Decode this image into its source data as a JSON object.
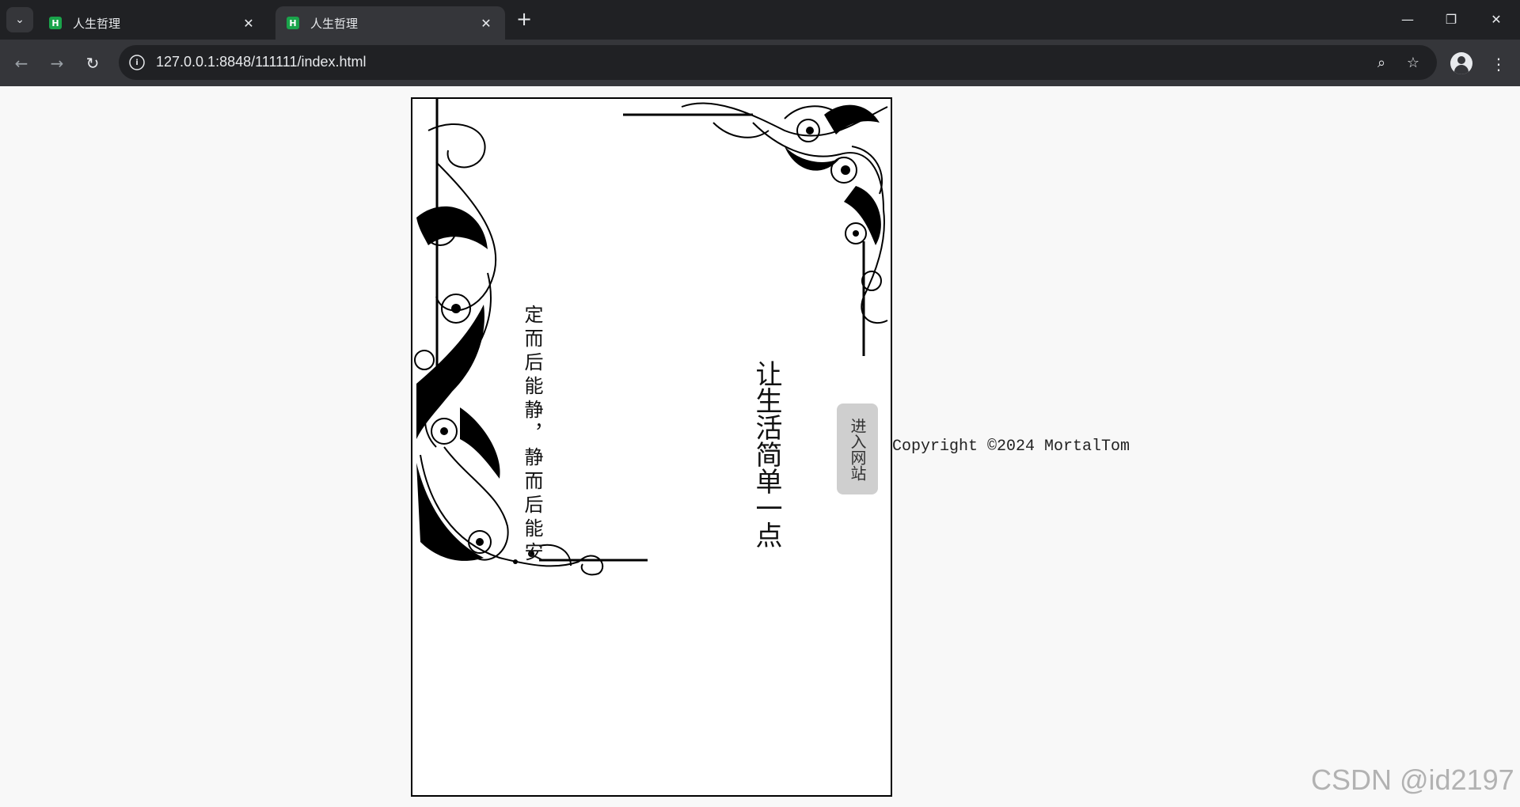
{
  "browser": {
    "tabs": [
      {
        "title": "人生哲理",
        "favicon": "H"
      },
      {
        "title": "人生哲理",
        "favicon": "H"
      }
    ],
    "url": "127.0.0.1:8848/111111/index.html",
    "accent": "#1aa44b"
  },
  "page": {
    "poem": "定而后能静，静而后能安",
    "title": "让生活简单一点",
    "enter_button": "进入网站",
    "copyright": "Copyright ©2024 MortalTom"
  },
  "watermark": "CSDN @id2197"
}
